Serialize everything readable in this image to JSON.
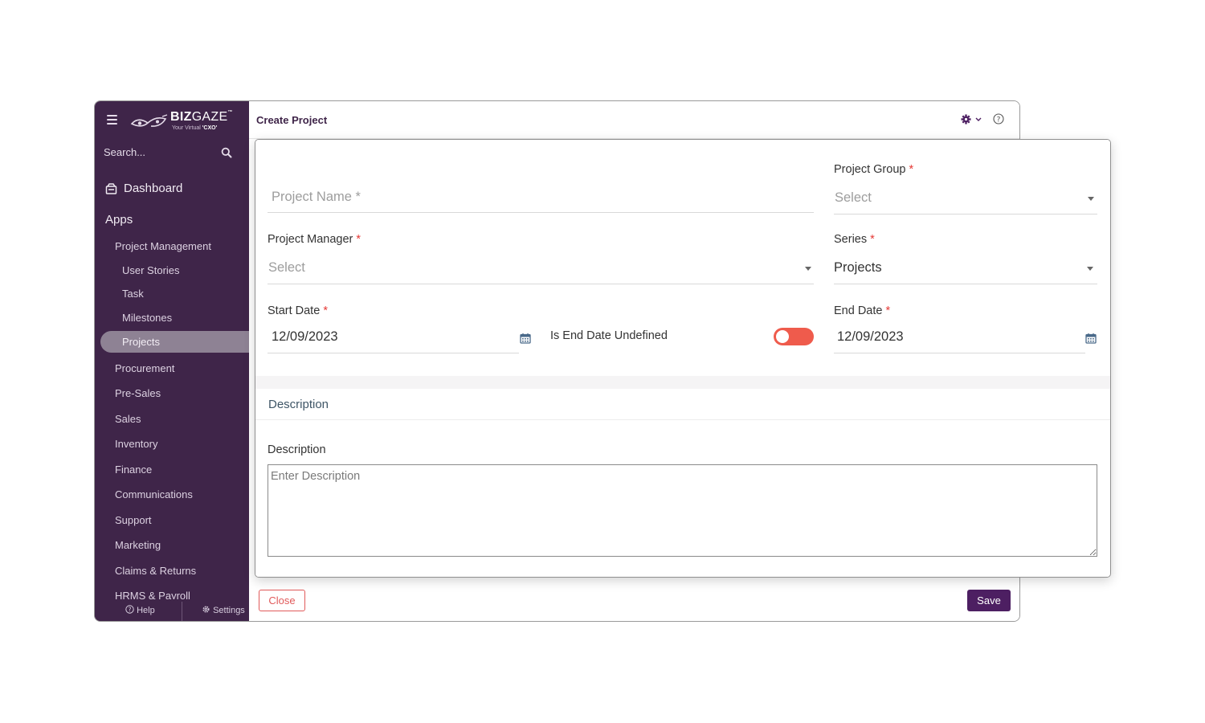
{
  "brand": {
    "name_bold": "BIZ",
    "name_light": "GAZE",
    "trademark": "™",
    "tagline_prefix": "Your Virtual",
    "tagline_em": "'CXO'"
  },
  "sidebar": {
    "search_placeholder": "Search...",
    "dashboard_label": "Dashboard",
    "apps_label": "Apps",
    "items": [
      {
        "label": "Project Management",
        "level": 1
      },
      {
        "label": "User Stories",
        "level": 2
      },
      {
        "label": "Task",
        "level": 2
      },
      {
        "label": "Milestones",
        "level": 2
      },
      {
        "label": "Projects",
        "level": 2,
        "active": true
      },
      {
        "label": "Procurement",
        "level": 1
      },
      {
        "label": "Pre-Sales",
        "level": 1
      },
      {
        "label": "Sales",
        "level": 1
      },
      {
        "label": "Inventory",
        "level": 1
      },
      {
        "label": "Finance",
        "level": 1
      },
      {
        "label": "Communications",
        "level": 1
      },
      {
        "label": "Support",
        "level": 1
      },
      {
        "label": "Marketing",
        "level": 1
      },
      {
        "label": "Claims & Returns",
        "level": 1
      },
      {
        "label": "HRMS & Payroll",
        "level": 1
      }
    ],
    "help_label": "Help",
    "settings_label": "Settings"
  },
  "header": {
    "title": "Create Project",
    "gear_icon": "gear-icon",
    "help_icon": "question-circle-icon"
  },
  "form": {
    "project_name": {
      "placeholder": "Project Name *"
    },
    "project_group": {
      "label": "Project Group",
      "required": "*",
      "placeholder": "Select"
    },
    "project_manager": {
      "label": "Project Manager",
      "required": "*",
      "placeholder": "Select"
    },
    "series": {
      "label": "Series",
      "required": "*",
      "value": "Projects"
    },
    "start_date": {
      "label": "Start Date",
      "required": "*",
      "value": "12/09/2023"
    },
    "end_date_undefined": {
      "label": "Is End Date Undefined",
      "state": "off"
    },
    "end_date": {
      "label": "End Date",
      "required": "*",
      "value": "12/09/2023"
    }
  },
  "description": {
    "section_title": "Description",
    "label": "Description",
    "placeholder": "Enter Description"
  },
  "footer": {
    "close_label": "Close",
    "save_label": "Save"
  },
  "colors": {
    "sidebar_bg": "#3f2549",
    "primary": "#4d1f62",
    "required": "#e53935",
    "toggle_off": "#ef5b4c"
  }
}
